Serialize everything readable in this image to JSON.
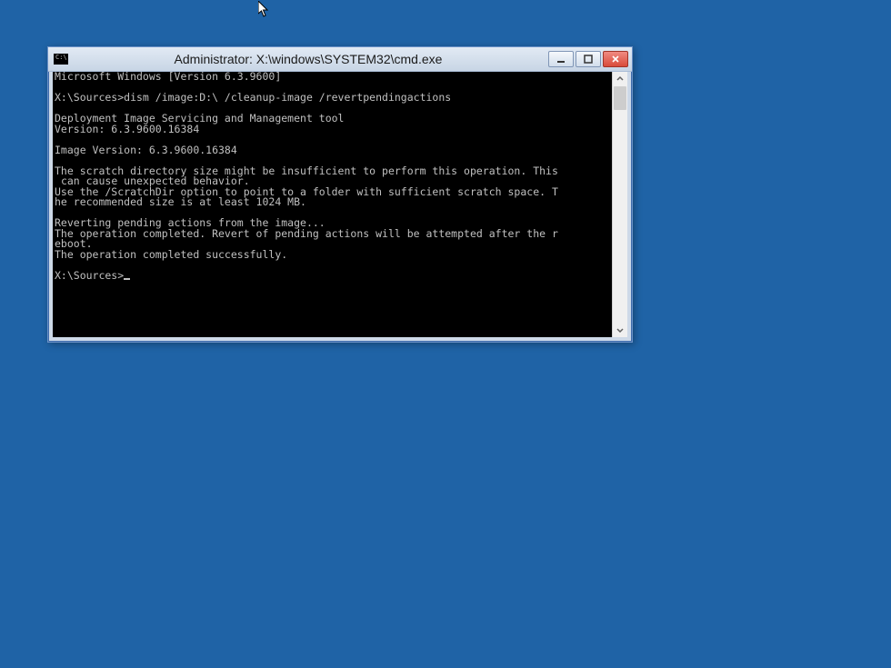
{
  "window": {
    "title": "Administrator: X:\\windows\\SYSTEM32\\cmd.exe",
    "icon_label": "C:\\"
  },
  "terminal": {
    "lines": [
      "Microsoft Windows [Version 6.3.9600]",
      "",
      "X:\\Sources>dism /image:D:\\ /cleanup-image /revertpendingactions",
      "",
      "Deployment Image Servicing and Management tool",
      "Version: 6.3.9600.16384",
      "",
      "Image Version: 6.3.9600.16384",
      "",
      "The scratch directory size might be insufficient to perform this operation. This",
      " can cause unexpected behavior.",
      "Use the /ScratchDir option to point to a folder with sufficient scratch space. T",
      "he recommended size is at least 1024 MB.",
      "",
      "Reverting pending actions from the image...",
      "The operation completed. Revert of pending actions will be attempted after the r",
      "eboot.",
      "The operation completed successfully.",
      "",
      "X:\\Sources>"
    ]
  }
}
